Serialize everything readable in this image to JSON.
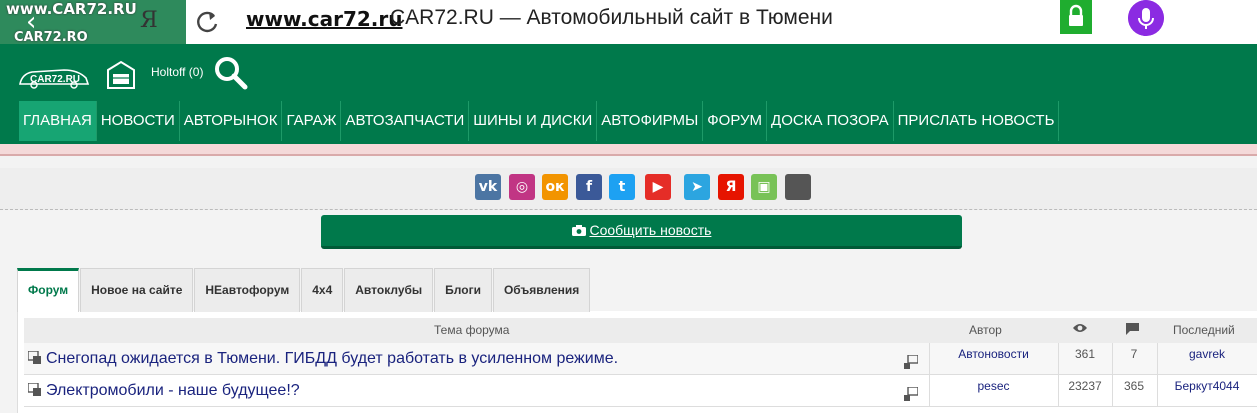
{
  "browser": {
    "watermark_url": "www.CAR72.RU",
    "watermark_name": "CAR72.RO",
    "yandex_glyph": "Я",
    "address_url": "www.car72.ru",
    "page_title": "CAR72.RU — Автомобильный сайт в Тюмени",
    "icons": [
      "back-arrow-icon",
      "reload-icon",
      "lock-icon",
      "microphone-icon"
    ]
  },
  "header": {
    "logo_text": "CAR72.RU",
    "user_link": "Holtoff (0)",
    "nav": [
      "ГЛАВНАЯ",
      "НОВОСТИ",
      "АВТОРЫНОК",
      "ГАРАЖ",
      "АВТОЗАПЧАСТИ",
      "ШИНЫ И ДИСКИ",
      "АВТОФИРМЫ",
      "ФОРУМ",
      "ДОСКА ПОЗОРА",
      "ПРИСЛАТЬ НОВОСТЬ"
    ],
    "active_nav": "ГЛАВНАЯ"
  },
  "social": [
    {
      "name": "vk-icon",
      "glyph": "vk",
      "color": "#4c75a3"
    },
    {
      "name": "instagram-icon",
      "glyph": "◎",
      "color": "#c13584"
    },
    {
      "name": "odnoklassniki-icon",
      "glyph": "ок",
      "color": "#f29400"
    },
    {
      "name": "facebook-icon",
      "glyph": "f",
      "color": "#3b5998"
    },
    {
      "name": "twitter-icon",
      "glyph": "t",
      "color": "#1da1f2"
    },
    {
      "name": "youtube-icon",
      "glyph": "▶",
      "color": "#e52d27"
    },
    {
      "name": "telegram-icon",
      "glyph": "➤",
      "color": "#2ca5e0"
    },
    {
      "name": "yandex-icon",
      "glyph": "Я",
      "color": "#e61400"
    },
    {
      "name": "android-icon",
      "glyph": "▣",
      "color": "#78c257"
    },
    {
      "name": "apple-icon",
      "glyph": "",
      "color": "#555555"
    }
  ],
  "report_button": "Сообщить новость",
  "tabs": [
    "Форум",
    "Новое на сайте",
    "НЕавтофорум",
    "4х4",
    "Автоклубы",
    "Блоги",
    "Объявления"
  ],
  "active_tab": "Форум",
  "table": {
    "headers": {
      "topic": "Тема форума",
      "author": "Автор",
      "last": "Последний"
    },
    "rows": [
      {
        "topic": "Снегопад ожидается в Тюмени. ГИБДД будет работать в усиленном режиме.",
        "author": "Автоновости",
        "views": "361",
        "posts": "7",
        "last": "gavrek"
      },
      {
        "topic": "Электромобили - наше будущее!?",
        "author": "pesec",
        "views": "23237",
        "posts": "365",
        "last": "Беркут4044"
      }
    ]
  },
  "colors": {
    "brand_green": "#00794b",
    "active_nav": "#17a573",
    "link": "#1a237e",
    "mic": "#8b2be2",
    "lock": "#1fad2f"
  }
}
